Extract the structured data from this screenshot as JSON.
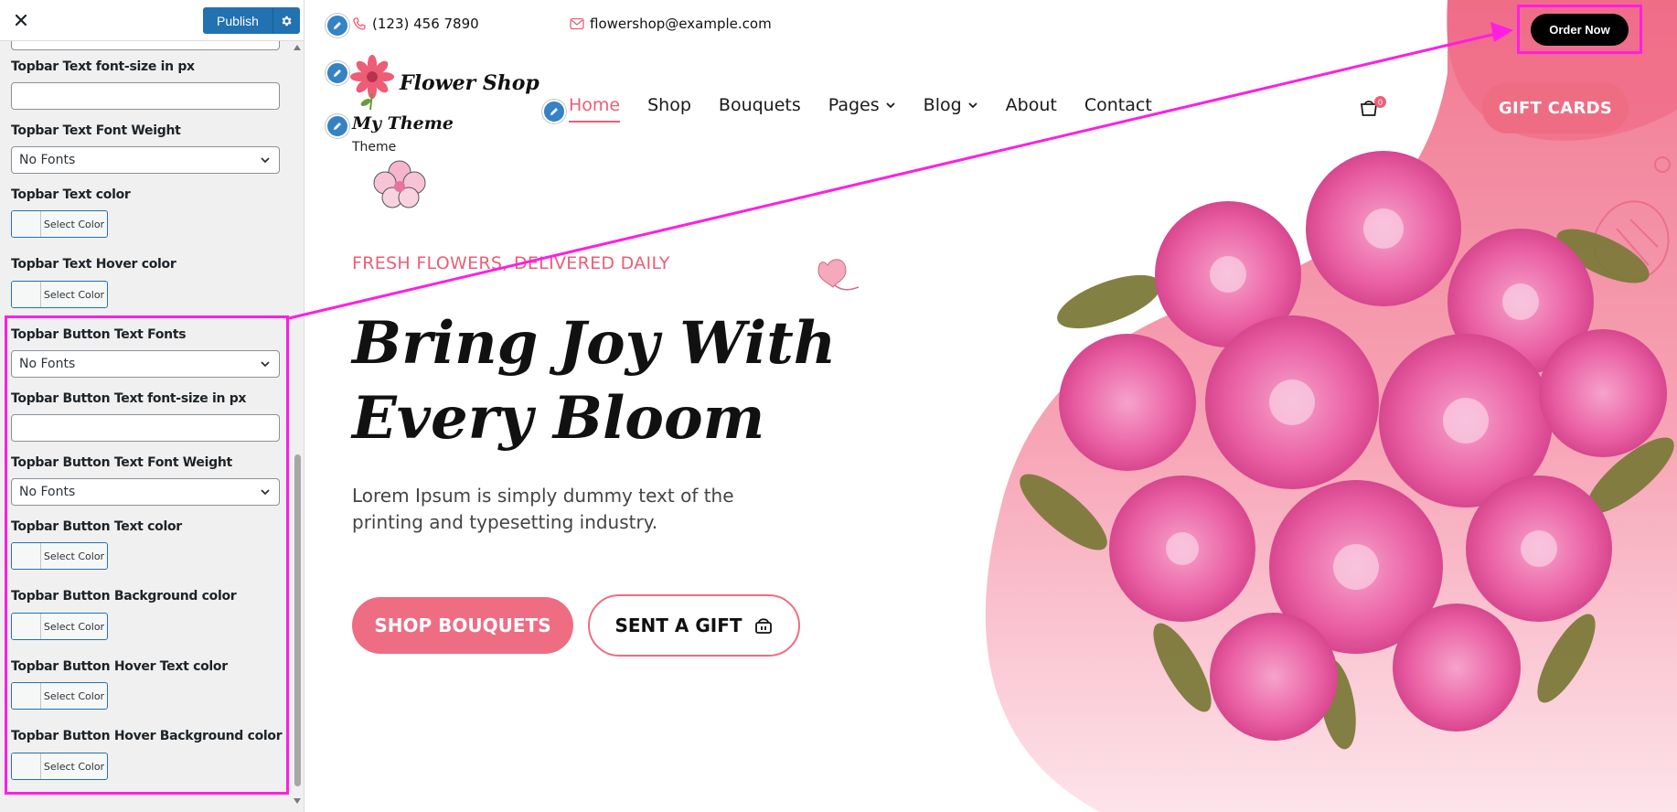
{
  "sidebar": {
    "publish_label": "Publish",
    "fields": [
      {
        "label": "Topbar Text font-size in px",
        "type": "text",
        "value": ""
      },
      {
        "label": "Topbar Text Font Weight",
        "type": "select",
        "value": "No Fonts"
      },
      {
        "label": "Topbar Text color",
        "type": "color",
        "button": "Select Color"
      },
      {
        "label": "Topbar Text Hover color",
        "type": "color",
        "button": "Select Color"
      },
      {
        "label": "Topbar Button Text Fonts",
        "type": "select",
        "value": "No Fonts"
      },
      {
        "label": "Topbar Button Text font-size in px",
        "type": "text",
        "value": ""
      },
      {
        "label": "Topbar Button Text Font Weight",
        "type": "select",
        "value": "No Fonts"
      },
      {
        "label": "Topbar Button Text color",
        "type": "color",
        "button": "Select Color"
      },
      {
        "label": "Topbar Button Background color",
        "type": "color",
        "button": "Select Color"
      },
      {
        "label": "Topbar Button Hover Text color",
        "type": "color",
        "button": "Select Color"
      },
      {
        "label": "Topbar Button Hover Background color",
        "type": "color",
        "button": "Select Color"
      }
    ]
  },
  "preview": {
    "topbar": {
      "phone": "(123) 456 7890",
      "email": "flowershop@example.com",
      "order_button": "Order Now"
    },
    "logo_text": "Flower Shop",
    "site_title": "My Theme",
    "tagline": "Theme",
    "nav": [
      {
        "label": "Home",
        "active": true,
        "dropdown": false
      },
      {
        "label": "Shop",
        "active": false,
        "dropdown": false
      },
      {
        "label": "Bouquets",
        "active": false,
        "dropdown": false
      },
      {
        "label": "Pages",
        "active": false,
        "dropdown": true
      },
      {
        "label": "Blog",
        "active": false,
        "dropdown": true
      },
      {
        "label": "About",
        "active": false,
        "dropdown": false
      },
      {
        "label": "Contact",
        "active": false,
        "dropdown": false
      }
    ],
    "cart_count": "0",
    "gift_cards": "GIFT CARDS",
    "hero": {
      "kicker": "FRESH FLOWERS, DELIVERED DAILY",
      "title_line1": "Bring Joy With",
      "title_line2": "Every Bloom",
      "text": "Lorem Ipsum is simply dummy text of the printing and typesetting industry.",
      "shop_button": "SHOP BOUQUETS",
      "gift_button": "SENT A GIFT"
    }
  },
  "colors": {
    "accent_pink": "#ee5d76",
    "publish_blue": "#2271b1",
    "highlight_magenta": "#ff1ee2"
  }
}
